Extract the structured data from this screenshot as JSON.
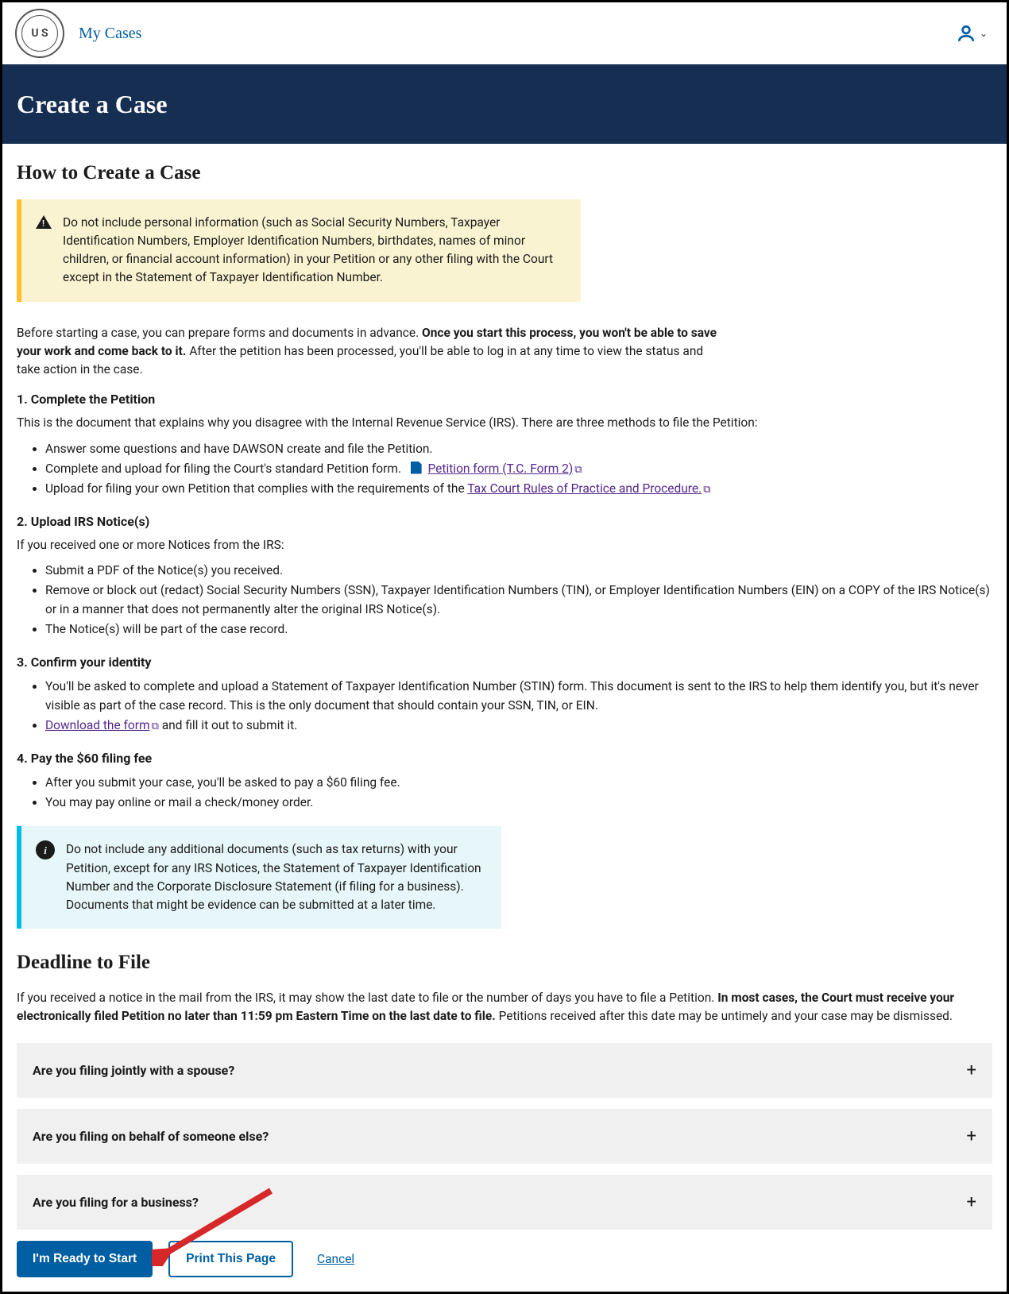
{
  "header": {
    "nav_link": "My Cases",
    "seal_text": "U S"
  },
  "title_bar": "Create a Case",
  "section1_heading": "How to Create a Case",
  "warning_text": "Do not include personal information (such as Social Security Numbers, Taxpayer Identification Numbers, Employer Identification Numbers, birthdates, names of minor children, or financial account information) in your Petition or any other filing with the Court except in the Statement of Taxpayer Identification Number.",
  "intro": {
    "part1": "Before starting a case, you can prepare forms and documents in advance. ",
    "bold": "Once you start this process, you won't be able to save your work and come back to it.",
    "part2": " After the petition has been processed, you'll be able to log in at any time to view the status and take action in the case."
  },
  "step1": {
    "title": "1. Complete the Petition",
    "desc": "This is the document that explains why you disagree with the Internal Revenue Service (IRS). There are three methods to file the Petition:",
    "item1": "Answer some questions and have DAWSON create and file the Petition.",
    "item2_prefix": "Complete and upload for filing the Court's standard Petition form.",
    "item2_link": "Petition form (T.C. Form 2)",
    "item3_prefix": "Upload for filing your own Petition that complies with the requirements of the ",
    "item3_link": "Tax Court Rules of Practice and Procedure."
  },
  "step2": {
    "title": "2. Upload IRS Notice(s)",
    "desc": "If you received one or more Notices from the IRS:",
    "item1": "Submit a PDF of the Notice(s) you received.",
    "item2": "Remove or block out (redact) Social Security Numbers (SSN), Taxpayer Identification Numbers (TIN), or Employer Identification Numbers (EIN) on a COPY of the IRS Notice(s) or in a manner that does not permanently alter the original IRS Notice(s).",
    "item3": "The Notice(s) will be part of the case record."
  },
  "step3": {
    "title": "3. Confirm your identity",
    "item1": "You'll be asked to complete and upload a Statement of Taxpayer Identification Number (STIN) form. This document is sent to the IRS to help them identify you, but it's never visible as part of the case record. This is the only document that should contain your SSN, TIN, or EIN.",
    "item2_link": "Download the form",
    "item2_suffix": " and fill it out to submit it."
  },
  "step4": {
    "title": "4. Pay the $60 filing fee",
    "item1": "After you submit your case, you'll be asked to pay a $60 filing fee.",
    "item2": "You may pay online or mail a check/money order."
  },
  "info_text": "Do not include any additional documents (such as tax returns) with your Petition, except for any IRS Notices, the Statement of Taxpayer Identification Number and the Corporate Disclosure Statement (if filing for a business). Documents that might be evidence can be submitted at a later time.",
  "section2_heading": "Deadline to File",
  "deadline_para": {
    "part1": "If you received a notice in the mail from the IRS, it may show the last date to file or the number of days you have to file a Petition. ",
    "bold": "In most cases, the Court must receive your electronically filed Petition no later than 11:59 pm Eastern Time on the last date to file.",
    "part2": " Petitions received after this date may be untimely and your case may be dismissed."
  },
  "accordions": {
    "item1": "Are you filing jointly with a spouse?",
    "item2": "Are you filing on behalf of someone else?",
    "item3": "Are you filing for a business?"
  },
  "actions": {
    "start": "I'm Ready to Start",
    "print": "Print This Page",
    "cancel": "Cancel"
  }
}
